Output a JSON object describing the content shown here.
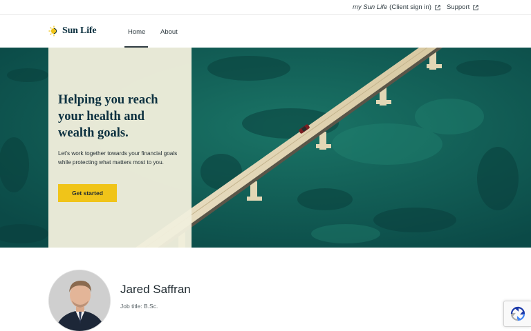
{
  "utility_bar": {
    "client_signin": {
      "brand": "my Sun Life",
      "label": "(Client sign in)"
    },
    "support": "Support"
  },
  "nav": {
    "logo_text": "Sun Life",
    "items": [
      {
        "label": "Home",
        "active": true
      },
      {
        "label": "About",
        "active": false
      }
    ]
  },
  "hero": {
    "title": "Helping you reach your health and wealth goals.",
    "body": "Let's work together towards your financial goals while protecting what matters most to you.",
    "cta_label": "Get started"
  },
  "profile": {
    "name": "Jared Saffran",
    "job_title": "Job title: B.Sc."
  },
  "colors": {
    "accent_yellow": "#f0c419",
    "brand_navy": "#0d3140",
    "water": "#0f5a55",
    "panel_cream": "#f0eedc"
  },
  "icons": [
    "external-link-icon",
    "sun-logo-icon",
    "recaptcha-icon"
  ]
}
